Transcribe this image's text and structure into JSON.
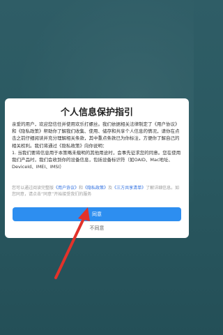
{
  "dialog": {
    "title": "个人信息保护指引",
    "body_p1": "亲爱的用户，欢迎您信任并使用欢乐打螺丝。我们依据相关法律制定了《用户协议》和《隐私政策》帮助你了解我们收集、使用、储存和共享个人信息的情况，请你在点击之前仔细阅读并充分理解相关条款，其中重点条款已为你标注，方便你了解自己的相关权利。我们将通过《隐私政策》向你说明：",
    "body_p2": "1. 当我们要将信息用于本策略未载明的其他用途时，会事先征求您的同意。您在使用我们产品时，我们会收到你的设备信息，包括设备标识符（如OAID、Mac地址、DeviceId、IMEI、IMSI）",
    "notice_prefix": "您可以通过阅读完整版",
    "link_user_agreement": "《用户协议》",
    "notice_and1": "和",
    "link_privacy": "《隐私政策》",
    "notice_and2": "及",
    "link_third_party": "《三方共享清单》",
    "notice_suffix": "了解详细信息。如您同意，请点击“同意”开始接受我们的服务",
    "agree_label": "同意",
    "disagree_label": "不同意"
  },
  "colors": {
    "primary": "#2d8ef0",
    "link": "#2f6fe0",
    "arrow": "#e3322a"
  }
}
